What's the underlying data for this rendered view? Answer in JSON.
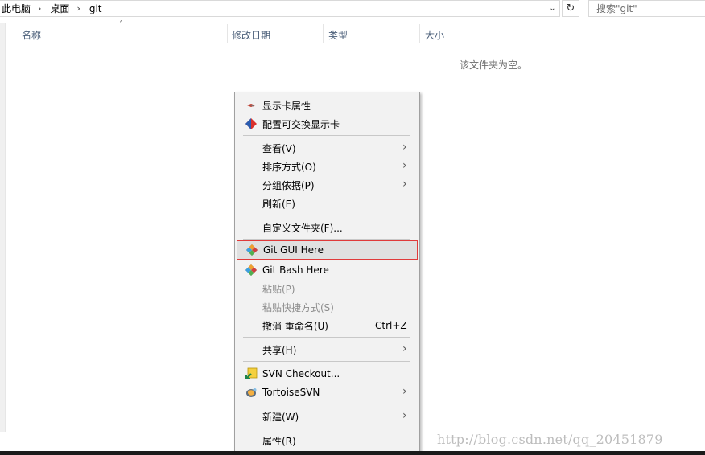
{
  "breadcrumb": [
    "此电脑",
    "桌面",
    "git"
  ],
  "search": {
    "placeholder": "搜索\"git\""
  },
  "columns": [
    "名称",
    "修改日期",
    "类型",
    "大小"
  ],
  "empty_message": "该文件夹为空。",
  "menu": {
    "display_props": "显示卡属性",
    "switchable_gpu": "配置可交换显示卡",
    "view": "查看(V)",
    "sort_by": "排序方式(O)",
    "group_by": "分组依据(P)",
    "refresh": "刷新(E)",
    "customize": "自定义文件夹(F)...",
    "git_gui": "Git GUI Here",
    "git_bash": "Git Bash Here",
    "paste": "粘贴(P)",
    "paste_shortcut": "粘贴快捷方式(S)",
    "undo_rename": "撤消 重命名(U)",
    "undo_shortcut": "Ctrl+Z",
    "share": "共享(H)",
    "svn_checkout": "SVN Checkout...",
    "tortoise_svn": "TortoiseSVN",
    "new": "新建(W)",
    "properties": "属性(R)"
  },
  "watermark": "http://blog.csdn.net/qq_20451879",
  "colors": {
    "hover_border": "#e03a3a",
    "header_text": "#4c607a"
  }
}
